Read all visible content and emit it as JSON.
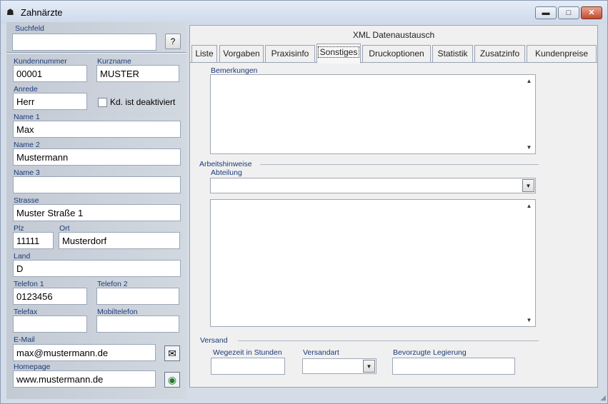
{
  "window": {
    "title": "Zahnärzte",
    "minimize_glyph": "▬",
    "maximize_glyph": "□",
    "close_glyph": "✕"
  },
  "left": {
    "suchfeld_label": "Suchfeld",
    "suchfeld_value": "",
    "search_button": "?",
    "kundennummer_label": "Kundennummer",
    "kundennummer_value": "00001",
    "kurzname_label": "Kurzname",
    "kurzname_value": "MUSTER",
    "anrede_label": "Anrede",
    "anrede_value": "Herr",
    "deaktiviert_label": "Kd. ist deaktiviert",
    "name1_label": "Name 1",
    "name1_value": "Max",
    "name2_label": "Name 2",
    "name2_value": "Mustermann",
    "name3_label": "Name 3",
    "name3_value": "",
    "strasse_label": "Strasse",
    "strasse_value": "Muster Straße 1",
    "plz_label": "Plz",
    "plz_value": "11111",
    "ort_label": "Ort",
    "ort_value": "Musterdorf",
    "land_label": "Land",
    "land_value": "D",
    "telefon1_label": "Telefon 1",
    "telefon1_value": "0123456",
    "telefon2_label": "Telefon 2",
    "telefon2_value": "",
    "telefax_label": "Telefax",
    "telefax_value": "",
    "mobil_label": "Mobiltelefon",
    "mobil_value": "",
    "email_label": "E-Mail",
    "email_value": "max@mustermann.de",
    "homepage_label": "Homepage",
    "homepage_value": "www.mustermann.de"
  },
  "tabs": {
    "top": "XML Datenaustausch",
    "items": [
      "Liste",
      "Vorgaben",
      "Praxisinfo",
      "Sonstiges",
      "Druckoptionen",
      "Statistik",
      "Zusatzinfo",
      "Kundenpreise"
    ],
    "active": "Sonstiges"
  },
  "sonstiges": {
    "bemerkungen_label": "Bemerkungen",
    "bemerkungen_value": "",
    "arbeitshinweise_label": "Arbeitshinweise",
    "abteilung_label": "Abteilung",
    "abteilung_value": "",
    "arbeitshinweise_value": "",
    "versand_label": "Versand",
    "wegezeit_label": "Wegezeit in Stunden",
    "wegezeit_value": "",
    "versandart_label": "Versandart",
    "versandart_value": "",
    "legierung_label": "Bevorzugte Legierung",
    "legierung_value": ""
  },
  "icons": {
    "app": "tooth-icon",
    "email": "email-send-icon",
    "homepage": "browser-icon"
  }
}
